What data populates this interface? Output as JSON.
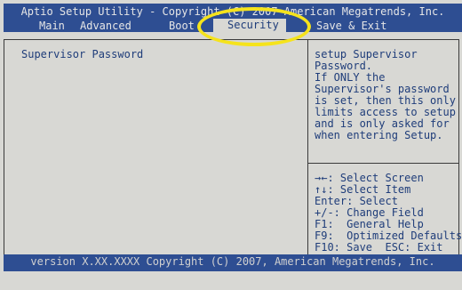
{
  "header": {
    "title": "Aptio Setup Utility - Copyright (C) 2007 American Megatrends, Inc."
  },
  "tabs": [
    {
      "label": "Main"
    },
    {
      "label": "Advanced"
    },
    {
      "label": "Boot"
    },
    {
      "label": "Security",
      "active": true
    },
    {
      "label": "Save & Exit"
    }
  ],
  "main": {
    "item_label": "Supervisor Password"
  },
  "help": {
    "lines": [
      "setup Supervisor",
      "Password.",
      "If ONLY the",
      "Supervisor's password",
      "is set, then this only",
      "limits access to setup",
      "and is only asked for",
      "when entering Setup."
    ]
  },
  "keys": {
    "lines": [
      "→←: Select Screen",
      "↑↓: Select Item",
      "Enter: Select",
      "+/-: Change Field",
      "F1:  General Help",
      "F9:  Optimized Defaults",
      "F10: Save  ESC: Exit"
    ]
  },
  "footer": {
    "text": "version X.XX.XXXX Copyright (C) 2007, American Megatrends, Inc."
  },
  "colors": {
    "bar_blue": "#2e4e92",
    "panel_gray": "#d8d8d4",
    "text_blue": "#1f3d7a",
    "highlight_yellow": "#f5e31c"
  }
}
